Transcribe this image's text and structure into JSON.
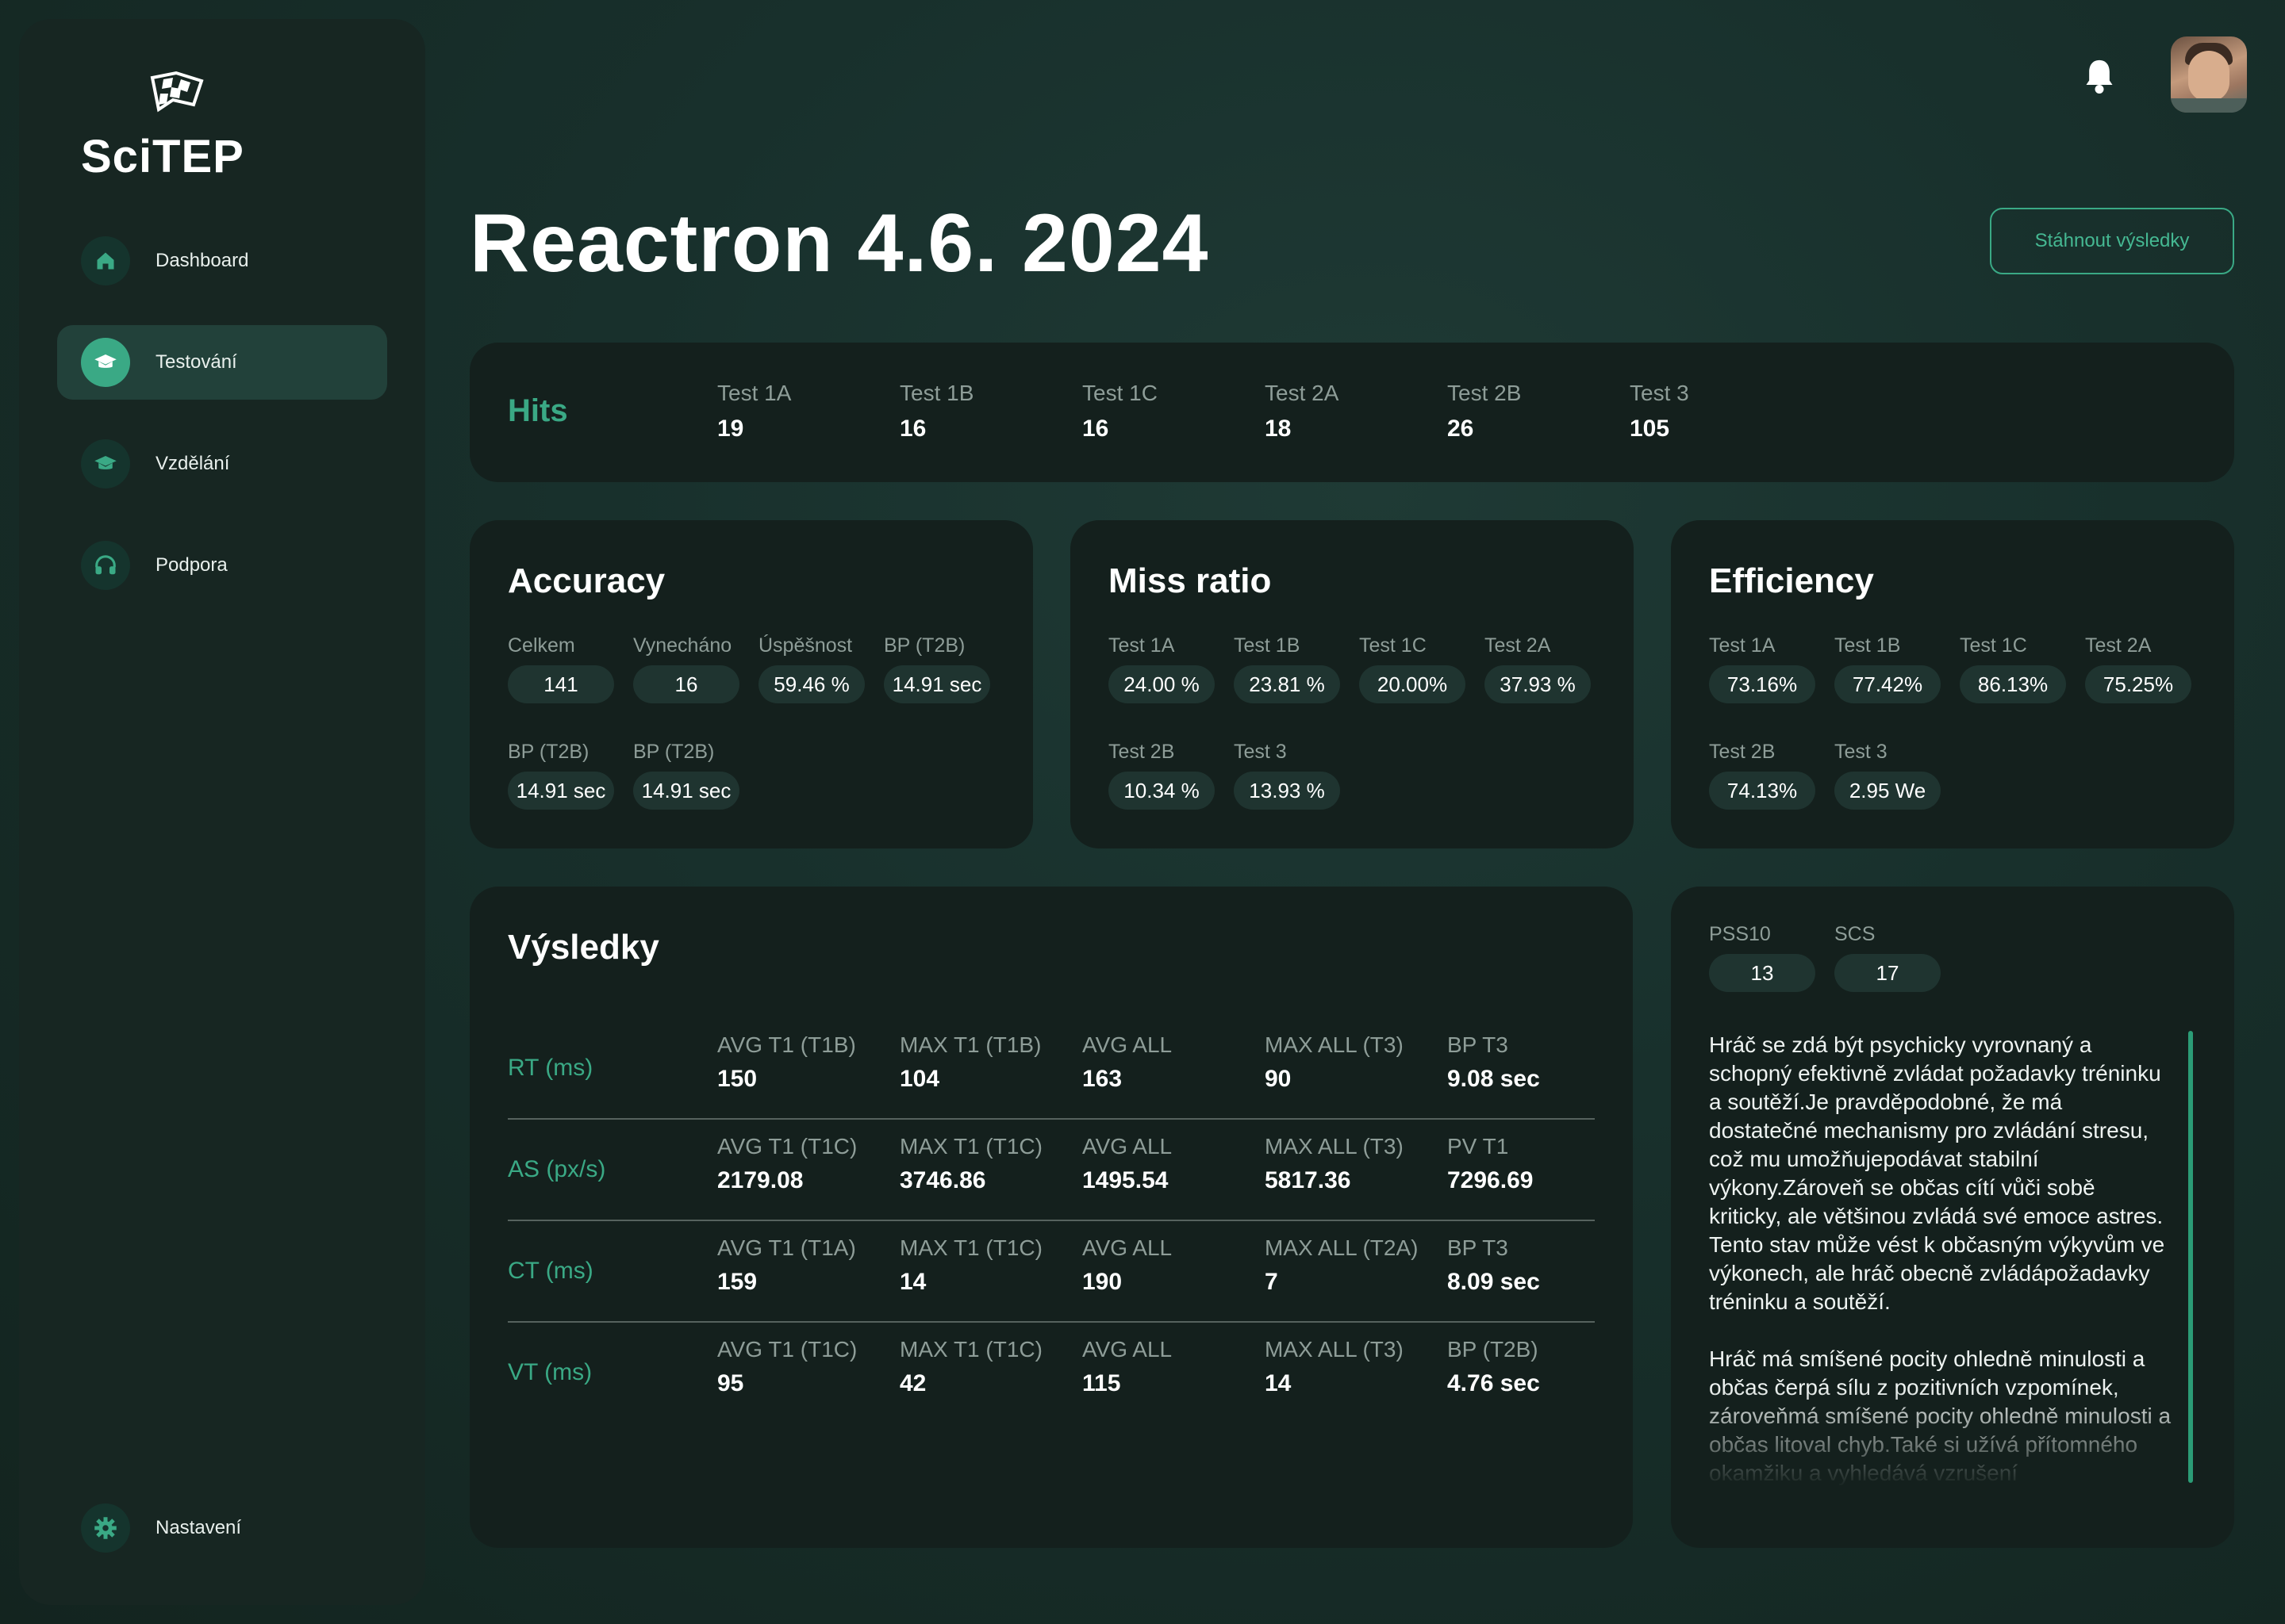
{
  "sidebar": {
    "logo": "SciTEP",
    "items": [
      {
        "label": "Dashboard",
        "icon": "home-icon"
      },
      {
        "label": "Testování",
        "icon": "graduation-cap-icon",
        "active": true
      },
      {
        "label": "Vzdělání",
        "icon": "graduation-cap-icon"
      },
      {
        "label": "Podpora",
        "icon": "headphones-icon"
      }
    ],
    "settings": {
      "label": "Nastavení",
      "icon": "gear-icon"
    }
  },
  "header": {
    "title": "Reactron 4.6. 2024",
    "download_label": "Stáhnout výsledky"
  },
  "hits": {
    "label": "Hits",
    "items": [
      {
        "label": "Test 1A",
        "value": "19"
      },
      {
        "label": "Test 1B",
        "value": "16"
      },
      {
        "label": "Test 1C",
        "value": "16"
      },
      {
        "label": "Test 2A",
        "value": "18"
      },
      {
        "label": "Test 2B",
        "value": "26"
      },
      {
        "label": "Test 3",
        "value": "105"
      }
    ]
  },
  "accuracy": {
    "title": "Accuracy",
    "items": [
      {
        "label": "Celkem",
        "value": "141"
      },
      {
        "label": "Vynecháno",
        "value": "16"
      },
      {
        "label": "Úspěšnost",
        "value": "59.46 %"
      },
      {
        "label": "BP (T2B)",
        "value": "14.91 sec"
      },
      {
        "label": "BP (T2B)",
        "value": "14.91 sec"
      },
      {
        "label": "BP (T2B)",
        "value": "14.91 sec"
      }
    ]
  },
  "miss_ratio": {
    "title": "Miss ratio",
    "items": [
      {
        "label": "Test 1A",
        "value": "24.00 %"
      },
      {
        "label": "Test 1B",
        "value": "23.81 %"
      },
      {
        "label": "Test 1C",
        "value": "20.00%"
      },
      {
        "label": "Test 2A",
        "value": "37.93 %"
      },
      {
        "label": "Test 2B",
        "value": "10.34 %"
      },
      {
        "label": "Test 3",
        "value": "13.93 %"
      }
    ]
  },
  "efficiency": {
    "title": "Efficiency",
    "items": [
      {
        "label": "Test 1A",
        "value": "73.16%"
      },
      {
        "label": "Test 1B",
        "value": "77.42%"
      },
      {
        "label": "Test 1C",
        "value": "86.13%"
      },
      {
        "label": "Test 2A",
        "value": "75.25%"
      },
      {
        "label": "Test 2B",
        "value": "74.13%"
      },
      {
        "label": "Test 3",
        "value": "2.95 We"
      }
    ]
  },
  "results": {
    "title": "Výsledky",
    "rows": [
      {
        "name": "RT (ms)",
        "cols": [
          {
            "label": "AVG T1 (T1B)",
            "value": "150"
          },
          {
            "label": "MAX T1 (T1B)",
            "value": "104"
          },
          {
            "label": "AVG ALL",
            "value": "163"
          },
          {
            "label": "MAX ALL (T3)",
            "value": "90"
          },
          {
            "label": "BP T3",
            "value": "9.08 sec"
          }
        ]
      },
      {
        "name": "AS (px/s)",
        "cols": [
          {
            "label": "AVG T1 (T1C)",
            "value": "2179.08"
          },
          {
            "label": "MAX T1 (T1C)",
            "value": "3746.86"
          },
          {
            "label": "AVG ALL",
            "value": "1495.54"
          },
          {
            "label": "MAX ALL (T3)",
            "value": "5817.36"
          },
          {
            "label": "PV T1",
            "value": "7296.69"
          }
        ]
      },
      {
        "name": "CT (ms)",
        "cols": [
          {
            "label": "AVG T1 (T1A)",
            "value": "159"
          },
          {
            "label": "MAX T1 (T1C)",
            "value": "14"
          },
          {
            "label": "AVG ALL",
            "value": "190"
          },
          {
            "label": "MAX ALL (T2A)",
            "value": "7"
          },
          {
            "label": "BP T3",
            "value": "8.09 sec"
          }
        ]
      },
      {
        "name": "VT (ms)",
        "cols": [
          {
            "label": "AVG T1 (T1C)",
            "value": "95"
          },
          {
            "label": "MAX T1 (T1C)",
            "value": "42"
          },
          {
            "label": "AVG ALL",
            "value": "115"
          },
          {
            "label": "MAX ALL (T3)",
            "value": "14"
          },
          {
            "label": "BP (T2B)",
            "value": "4.76 sec"
          }
        ]
      }
    ]
  },
  "psych": {
    "scores": [
      {
        "label": "PSS10",
        "value": "13"
      },
      {
        "label": "SCS",
        "value": "17"
      }
    ],
    "paragraphs": [
      "Hráč se zdá být psychicky vyrovnaný a schopný efektivně zvládat požadavky tréninku a soutěží.Je pravděpodobné, že má dostatečné mechanismy pro zvládání stresu, což mu umožňujepodávat stabilní výkony.Zároveň se občas cítí vůči sobě kriticky, ale většinou zvládá své emoce astres. Tento stav může vést k občasným výkyvům ve výkonech, ale hráč obecně zvládápožadavky tréninku a soutěží.",
      "Hráč má smíšené pocity ohledně minulosti a občas čerpá sílu z pozitivních vzpomínek, zároveňmá smíšené pocity ohledně minulosti a občas litoval chyb.Také si užívá přítomného okamžiku a vyhledává vzrušení"
    ]
  },
  "colors": {
    "accent": "#3aa985",
    "card": "#14201d",
    "sidebar": "#172622",
    "pill": "#1f3430"
  }
}
